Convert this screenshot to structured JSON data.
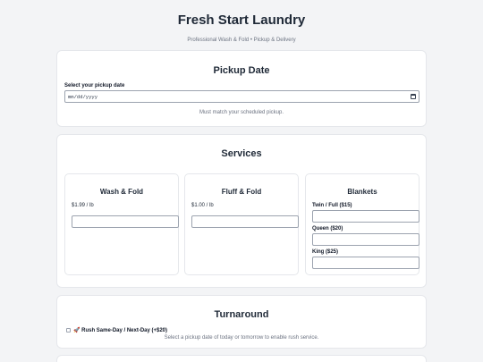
{
  "header": {
    "title": "Fresh Start Laundry",
    "subtitle": "Professional Wash & Fold • Pickup & Delivery"
  },
  "pickup": {
    "section_title": "Pickup Date",
    "field_label": "Select your pickup date",
    "placeholder": "mm/dd/yyyy",
    "help_text": "Must match your scheduled pickup."
  },
  "services": {
    "section_title": "Services",
    "wash_fold": {
      "title": "Wash & Fold",
      "price": "$1.99 / lb"
    },
    "fluff_fold": {
      "title": "Fluff & Fold",
      "price": "$1.00 / lb"
    },
    "blankets": {
      "title": "Blankets",
      "twin_full_label": "Twin / Full ($15)",
      "queen_label": "Queen ($20)",
      "king_label": "King ($25)"
    }
  },
  "turnaround": {
    "section_title": "Turnaround",
    "rush_label": "🚀 Rush Same-Day / Next-Day (+$20)",
    "rush_help": "Select a pickup date of today or tomorrow to enable rush service."
  }
}
